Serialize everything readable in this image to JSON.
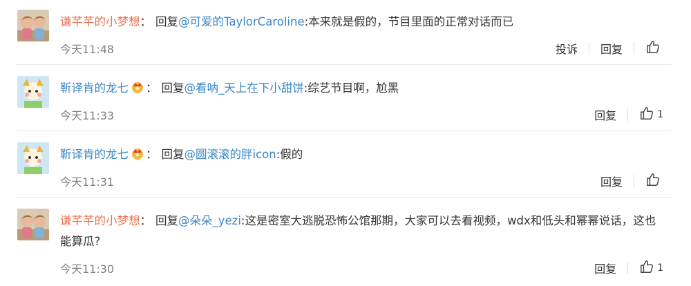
{
  "comments": [
    {
      "user": "谦芊芊的小梦想",
      "colon": "：",
      "reply_prefix": "回复",
      "reply_to": "@可爱的TaylorCaroline",
      "text": ":本来就是假的，节目里面的正常对话而已",
      "time": "今天11:48",
      "report": "投诉",
      "reply": "回复",
      "likes": ""
    },
    {
      "user": "靳译肯的龙七",
      "colon": "：",
      "reply_prefix": "回复",
      "reply_to": "@看呐_天上在下小甜饼",
      "text": ":综艺节目啊，尬黑",
      "time": "今天11:33",
      "reply": "回复",
      "likes": "1"
    },
    {
      "user": "靳译肯的龙七",
      "colon": "：",
      "reply_prefix": "回复",
      "reply_to": "@圆滚滚的胖icon",
      "text": ":假的",
      "time": "今天11:31",
      "reply": "回复",
      "likes": ""
    },
    {
      "user": "谦芊芊的小梦想",
      "colon": "：",
      "reply_prefix": "回复",
      "reply_to": "@朵朵_yezi",
      "text": ":这是密室大逃脱恐怖公馆那期，大家可以去看视频，wdx和低头和幂幂说话，这也能算瓜?",
      "time": "今天11:30",
      "reply": "回复",
      "likes": "1"
    }
  ],
  "colors": {
    "username": "#eb7350",
    "link": "#3b86c6",
    "time": "#808080"
  },
  "icons": {
    "like": "thumbs-up-icon",
    "crown": "crown-badge-icon"
  }
}
